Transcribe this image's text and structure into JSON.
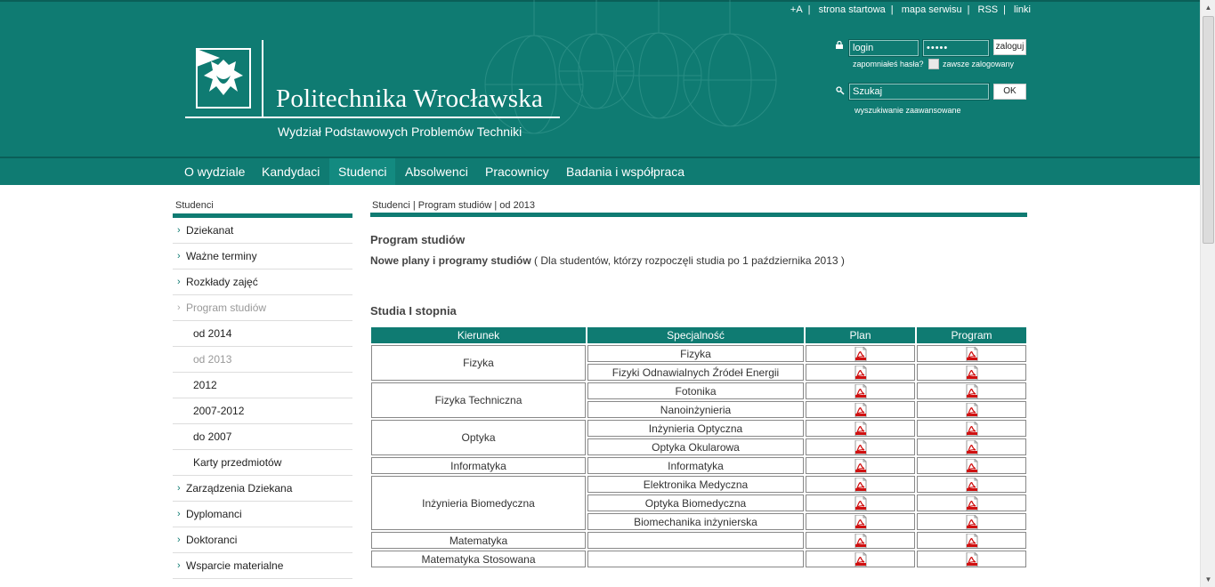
{
  "header": {
    "top_links": [
      "+A",
      "strona startowa",
      "mapa serwisu",
      "RSS",
      "linki"
    ],
    "title": "Politechnika Wrocławska",
    "subtitle": "Wydział Podstawowych Problemów Techniki"
  },
  "login": {
    "login_value": "login",
    "password_value": "•••••",
    "login_button": "zaloguj",
    "forgot_link": "zapomniałeś hasła?",
    "remember_label": "zawsze zalogowany"
  },
  "search": {
    "value": "Szukaj",
    "button": "OK",
    "advanced": "wyszukiwanie zaawansowane"
  },
  "nav": {
    "items": [
      "O wydziale",
      "Kandydaci",
      "Studenci",
      "Absolwenci",
      "Pracownicy",
      "Badania i współpraca"
    ],
    "active": "Studenci"
  },
  "sidebar": {
    "heading": "Studenci",
    "items": [
      {
        "label": "Dziekanat",
        "type": "main"
      },
      {
        "label": "Ważne terminy",
        "type": "main"
      },
      {
        "label": "Rozkłady zajęć",
        "type": "main"
      },
      {
        "label": "Program studiów",
        "type": "main-dim"
      },
      {
        "label": "od 2014",
        "type": "sub"
      },
      {
        "label": "od 2013",
        "type": "sub-dim"
      },
      {
        "label": "2012",
        "type": "sub"
      },
      {
        "label": "2007-2012",
        "type": "sub"
      },
      {
        "label": "do 2007",
        "type": "sub"
      },
      {
        "label": "Karty przedmiotów",
        "type": "sub"
      },
      {
        "label": "Zarządzenia Dziekana",
        "type": "main"
      },
      {
        "label": "Dyplomanci",
        "type": "main"
      },
      {
        "label": "Doktoranci",
        "type": "main"
      },
      {
        "label": "Wsparcie materialne",
        "type": "main"
      }
    ]
  },
  "content": {
    "breadcrumb": "Studenci | Program studiów | od 2013",
    "page_title": "Program studiów",
    "intro_bold": "Nowe plany i programy studiów",
    "intro_rest": " ( Dla studentów, którzy rozpoczęli studia po 1 października 2013 )",
    "section_title": "Studia I stopnia",
    "table": {
      "headers": [
        "Kierunek",
        "Specjalność",
        "Plan",
        "Program"
      ],
      "groups": [
        {
          "kierunek": "Fizyka",
          "specs": [
            "Fizyka",
            "Fizyki Odnawialnych Źródeł Energii"
          ]
        },
        {
          "kierunek": "Fizyka Techniczna",
          "specs": [
            "Fotonika",
            "Nanoinżynieria"
          ]
        },
        {
          "kierunek": "Optyka",
          "specs": [
            "Inżynieria Optyczna",
            "Optyka Okularowa"
          ]
        },
        {
          "kierunek": "Informatyka",
          "specs": [
            "Informatyka"
          ]
        },
        {
          "kierunek": "Inżynieria Biomedyczna",
          "specs": [
            "Elektronika Medyczna",
            "Optyka Biomedyczna",
            "Biomechanika inżynierska"
          ]
        },
        {
          "kierunek": "Matematyka",
          "specs": [
            ""
          ]
        },
        {
          "kierunek": "Matematyka Stosowana",
          "specs": [
            ""
          ]
        }
      ]
    }
  },
  "colors": {
    "brand": "#0f7b72",
    "brand_dark": "#0a5f58"
  },
  "icons": {
    "pdf": "pdf-icon",
    "lock": "lock-icon",
    "search": "search-icon"
  }
}
